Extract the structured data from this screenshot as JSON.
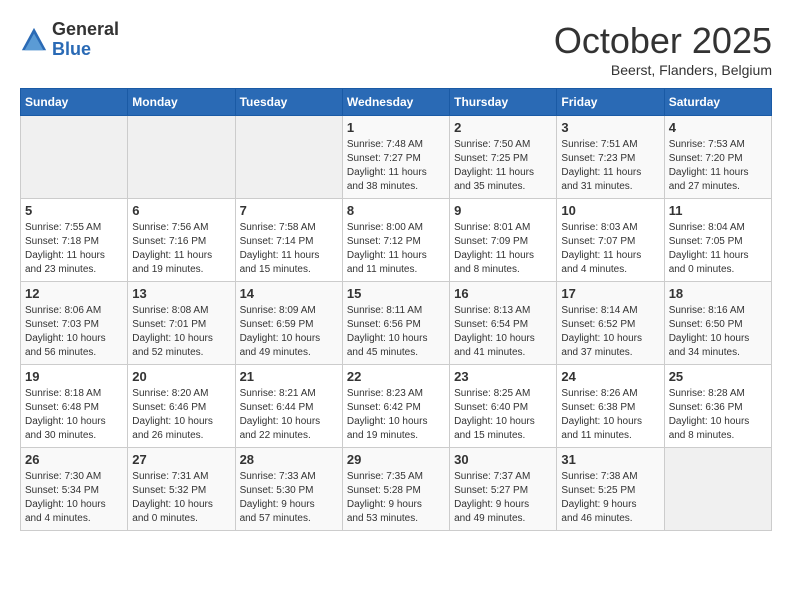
{
  "logo": {
    "general": "General",
    "blue": "Blue"
  },
  "title": "October 2025",
  "location": "Beerst, Flanders, Belgium",
  "weekdays": [
    "Sunday",
    "Monday",
    "Tuesday",
    "Wednesday",
    "Thursday",
    "Friday",
    "Saturday"
  ],
  "weeks": [
    [
      {
        "day": "",
        "info": ""
      },
      {
        "day": "",
        "info": ""
      },
      {
        "day": "",
        "info": ""
      },
      {
        "day": "1",
        "info": "Sunrise: 7:48 AM\nSunset: 7:27 PM\nDaylight: 11 hours\nand 38 minutes."
      },
      {
        "day": "2",
        "info": "Sunrise: 7:50 AM\nSunset: 7:25 PM\nDaylight: 11 hours\nand 35 minutes."
      },
      {
        "day": "3",
        "info": "Sunrise: 7:51 AM\nSunset: 7:23 PM\nDaylight: 11 hours\nand 31 minutes."
      },
      {
        "day": "4",
        "info": "Sunrise: 7:53 AM\nSunset: 7:20 PM\nDaylight: 11 hours\nand 27 minutes."
      }
    ],
    [
      {
        "day": "5",
        "info": "Sunrise: 7:55 AM\nSunset: 7:18 PM\nDaylight: 11 hours\nand 23 minutes."
      },
      {
        "day": "6",
        "info": "Sunrise: 7:56 AM\nSunset: 7:16 PM\nDaylight: 11 hours\nand 19 minutes."
      },
      {
        "day": "7",
        "info": "Sunrise: 7:58 AM\nSunset: 7:14 PM\nDaylight: 11 hours\nand 15 minutes."
      },
      {
        "day": "8",
        "info": "Sunrise: 8:00 AM\nSunset: 7:12 PM\nDaylight: 11 hours\nand 11 minutes."
      },
      {
        "day": "9",
        "info": "Sunrise: 8:01 AM\nSunset: 7:09 PM\nDaylight: 11 hours\nand 8 minutes."
      },
      {
        "day": "10",
        "info": "Sunrise: 8:03 AM\nSunset: 7:07 PM\nDaylight: 11 hours\nand 4 minutes."
      },
      {
        "day": "11",
        "info": "Sunrise: 8:04 AM\nSunset: 7:05 PM\nDaylight: 11 hours\nand 0 minutes."
      }
    ],
    [
      {
        "day": "12",
        "info": "Sunrise: 8:06 AM\nSunset: 7:03 PM\nDaylight: 10 hours\nand 56 minutes."
      },
      {
        "day": "13",
        "info": "Sunrise: 8:08 AM\nSunset: 7:01 PM\nDaylight: 10 hours\nand 52 minutes."
      },
      {
        "day": "14",
        "info": "Sunrise: 8:09 AM\nSunset: 6:59 PM\nDaylight: 10 hours\nand 49 minutes."
      },
      {
        "day": "15",
        "info": "Sunrise: 8:11 AM\nSunset: 6:56 PM\nDaylight: 10 hours\nand 45 minutes."
      },
      {
        "day": "16",
        "info": "Sunrise: 8:13 AM\nSunset: 6:54 PM\nDaylight: 10 hours\nand 41 minutes."
      },
      {
        "day": "17",
        "info": "Sunrise: 8:14 AM\nSunset: 6:52 PM\nDaylight: 10 hours\nand 37 minutes."
      },
      {
        "day": "18",
        "info": "Sunrise: 8:16 AM\nSunset: 6:50 PM\nDaylight: 10 hours\nand 34 minutes."
      }
    ],
    [
      {
        "day": "19",
        "info": "Sunrise: 8:18 AM\nSunset: 6:48 PM\nDaylight: 10 hours\nand 30 minutes."
      },
      {
        "day": "20",
        "info": "Sunrise: 8:20 AM\nSunset: 6:46 PM\nDaylight: 10 hours\nand 26 minutes."
      },
      {
        "day": "21",
        "info": "Sunrise: 8:21 AM\nSunset: 6:44 PM\nDaylight: 10 hours\nand 22 minutes."
      },
      {
        "day": "22",
        "info": "Sunrise: 8:23 AM\nSunset: 6:42 PM\nDaylight: 10 hours\nand 19 minutes."
      },
      {
        "day": "23",
        "info": "Sunrise: 8:25 AM\nSunset: 6:40 PM\nDaylight: 10 hours\nand 15 minutes."
      },
      {
        "day": "24",
        "info": "Sunrise: 8:26 AM\nSunset: 6:38 PM\nDaylight: 10 hours\nand 11 minutes."
      },
      {
        "day": "25",
        "info": "Sunrise: 8:28 AM\nSunset: 6:36 PM\nDaylight: 10 hours\nand 8 minutes."
      }
    ],
    [
      {
        "day": "26",
        "info": "Sunrise: 7:30 AM\nSunset: 5:34 PM\nDaylight: 10 hours\nand 4 minutes."
      },
      {
        "day": "27",
        "info": "Sunrise: 7:31 AM\nSunset: 5:32 PM\nDaylight: 10 hours\nand 0 minutes."
      },
      {
        "day": "28",
        "info": "Sunrise: 7:33 AM\nSunset: 5:30 PM\nDaylight: 9 hours\nand 57 minutes."
      },
      {
        "day": "29",
        "info": "Sunrise: 7:35 AM\nSunset: 5:28 PM\nDaylight: 9 hours\nand 53 minutes."
      },
      {
        "day": "30",
        "info": "Sunrise: 7:37 AM\nSunset: 5:27 PM\nDaylight: 9 hours\nand 49 minutes."
      },
      {
        "day": "31",
        "info": "Sunrise: 7:38 AM\nSunset: 5:25 PM\nDaylight: 9 hours\nand 46 minutes."
      },
      {
        "day": "",
        "info": ""
      }
    ]
  ]
}
